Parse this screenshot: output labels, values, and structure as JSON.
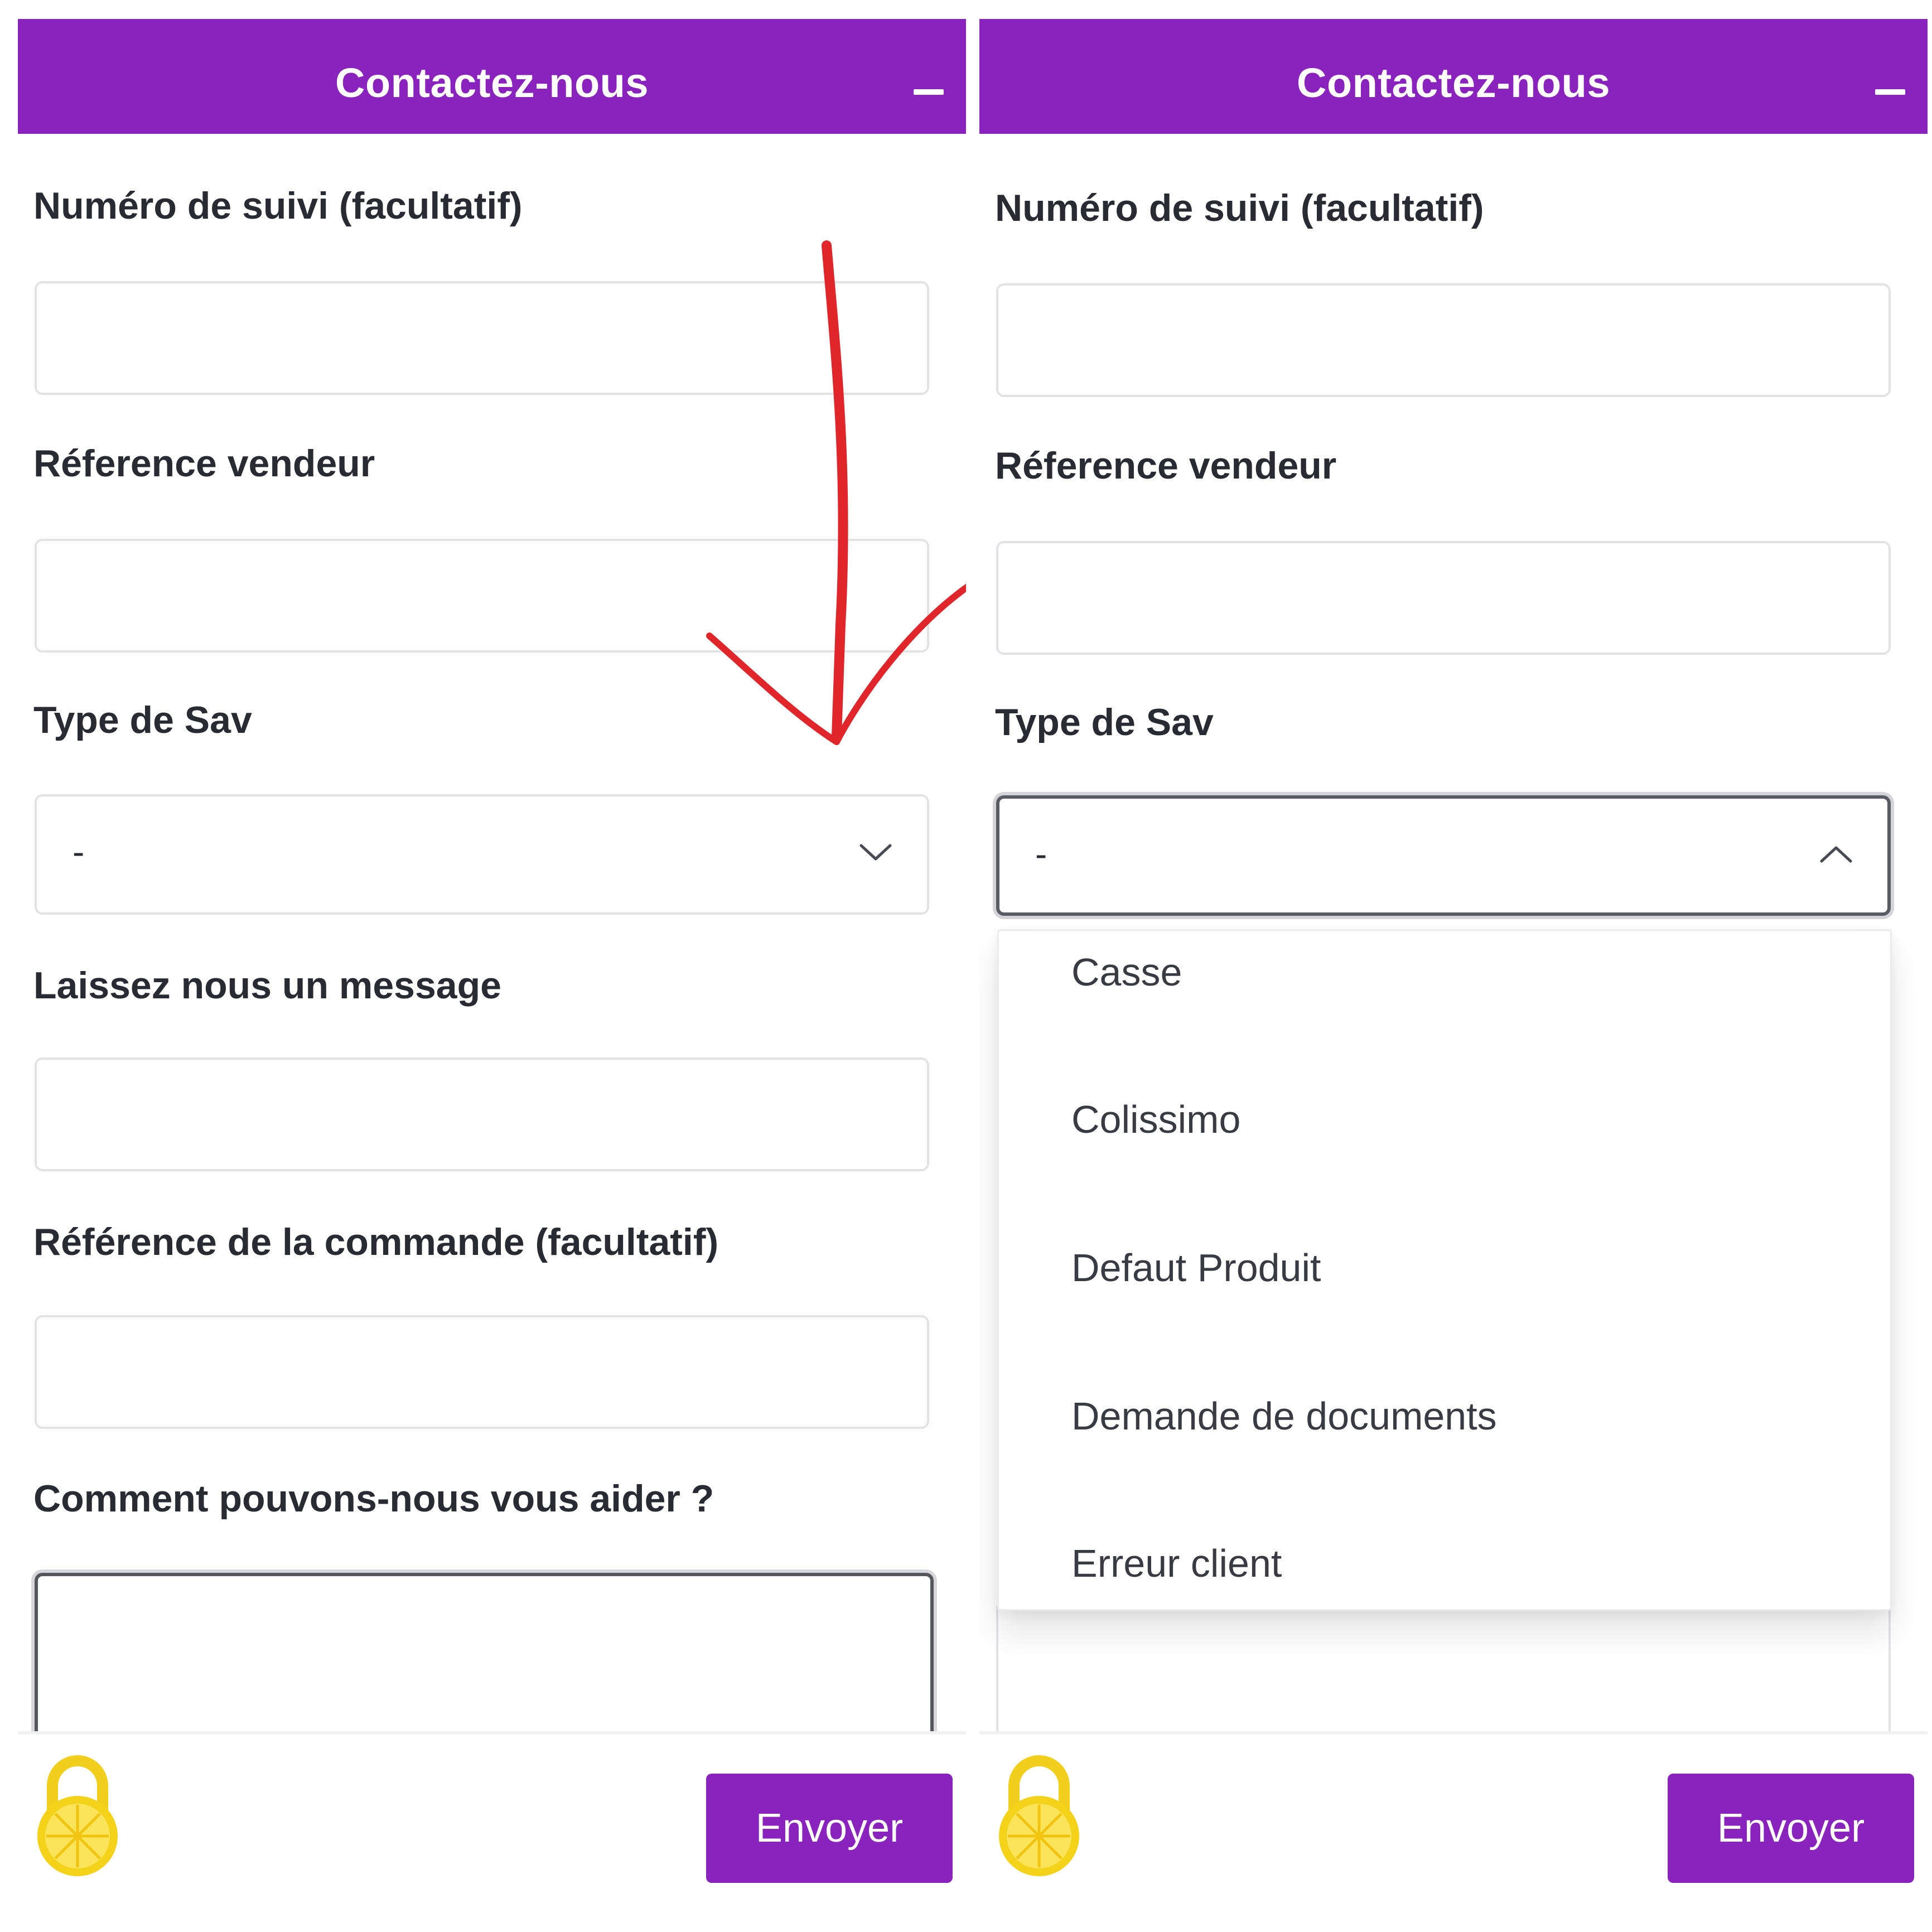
{
  "header": {
    "title": "Contactez-nous",
    "minimize_icon": "minus-icon"
  },
  "form": {
    "tracking_label": "Numéro de suivi (facultatif)",
    "seller_ref_label": "Réference vendeur",
    "sav_type_label": "Type de Sav",
    "sav_type_value": "-",
    "message_label": "Laissez nous un message",
    "order_ref_label": "Référence de la commande (facultatif)",
    "help_label": "Comment pouvons-nous vous aider ?"
  },
  "dropdown": {
    "options": [
      "Casse",
      "Colissimo",
      "Defaut Produit",
      "Demande de documents",
      "Erreur client"
    ]
  },
  "footer": {
    "send_label": "Envoyer",
    "lock_icon": "lemon-lock-icon"
  },
  "colors": {
    "brand": "#8a22bd",
    "annotation": "#e0262b",
    "lock": "#f4d21a"
  }
}
